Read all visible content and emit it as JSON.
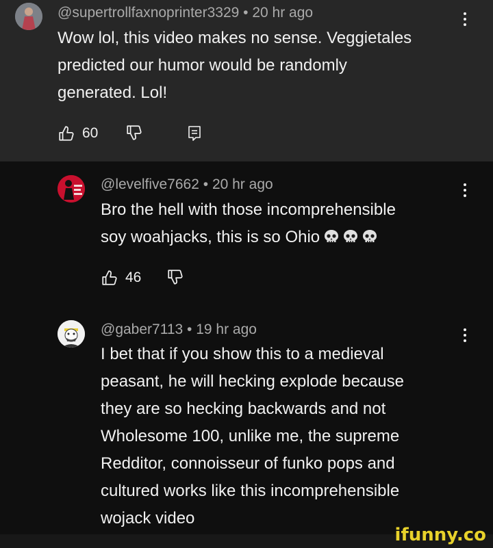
{
  "comments": [
    {
      "handle": "@supertrollfaxnoprinter3329",
      "time": "20 hr ago",
      "lines": [
        "Wow lol, this video makes no sense. Veggietales",
        "predicted our humor would be randomly",
        "generated. Lol!"
      ],
      "likes": "60"
    },
    {
      "handle": "@levelfive7662",
      "time": "20 hr ago",
      "lines": [
        "Bro the hell with those incomprehensible",
        "soy woahjacks, this is so Ohio"
      ],
      "likes": "46"
    },
    {
      "handle": "@gaber7113",
      "time": "19 hr ago",
      "lines": [
        "I bet that if you show this to a medieval",
        "peasant, he will hecking explode because",
        "they are so hecking backwards and not",
        "Wholesome 100, unlike me, the supreme",
        "Redditor, connoisseur of funko pops and",
        "cultured works like this incomprehensible",
        "wojack video"
      ]
    }
  ],
  "separator": " • ",
  "watermark": "ifunny.co",
  "icons": [
    "thumbs-up-icon",
    "thumbs-down-icon",
    "reply-icon",
    "more-vert-icon",
    "skull-emoji-icon"
  ],
  "colors": {
    "highlight_bg": "#272727",
    "bg": "#0f0f0f",
    "text": "#f1f1f1",
    "meta": "#aaaaaa",
    "watermark": "#e8d22b"
  }
}
